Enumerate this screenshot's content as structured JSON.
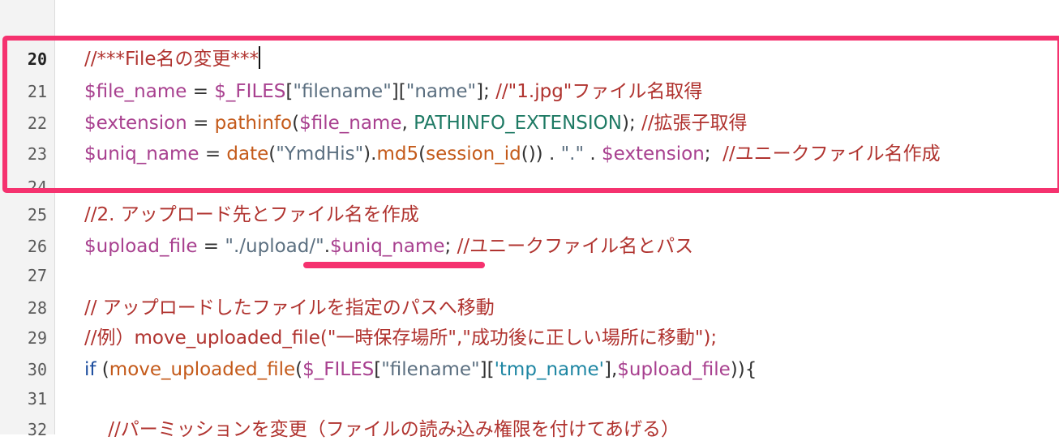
{
  "editor": {
    "lines": [
      {
        "number": "20",
        "tokens": [
          {
            "t": "//***File名の変更***",
            "c": "cm"
          }
        ]
      },
      {
        "number": "21",
        "tokens": [
          {
            "t": "$file_name",
            "c": "vr"
          },
          {
            "t": " = ",
            "c": "pl"
          },
          {
            "t": "$_FILES",
            "c": "vr"
          },
          {
            "t": "[",
            "c": "pl"
          },
          {
            "t": "\"filename\"",
            "c": "st"
          },
          {
            "t": "][",
            "c": "pl"
          },
          {
            "t": "\"name\"",
            "c": "st"
          },
          {
            "t": "]; ",
            "c": "pl"
          },
          {
            "t": "//\"1.jpg\"ファイル名取得",
            "c": "cm"
          }
        ]
      },
      {
        "number": "22",
        "tokens": [
          {
            "t": "$extension",
            "c": "vr"
          },
          {
            "t": " = ",
            "c": "pl"
          },
          {
            "t": "pathinfo",
            "c": "fn"
          },
          {
            "t": "(",
            "c": "pl"
          },
          {
            "t": "$file_name",
            "c": "vr"
          },
          {
            "t": ", ",
            "c": "pl"
          },
          {
            "t": "PATHINFO_EXTENSION",
            "c": "cn"
          },
          {
            "t": "); ",
            "c": "pl"
          },
          {
            "t": "//拡張子取得",
            "c": "cm"
          }
        ]
      },
      {
        "number": "23",
        "tokens": [
          {
            "t": "$uniq_name",
            "c": "vr"
          },
          {
            "t": " = ",
            "c": "pl"
          },
          {
            "t": "date",
            "c": "fn"
          },
          {
            "t": "(",
            "c": "pl"
          },
          {
            "t": "\"YmdHis\"",
            "c": "st"
          },
          {
            "t": ").",
            "c": "pl"
          },
          {
            "t": "md5",
            "c": "fn"
          },
          {
            "t": "(",
            "c": "pl"
          },
          {
            "t": "session_id",
            "c": "fn"
          },
          {
            "t": "()) . ",
            "c": "pl"
          },
          {
            "t": "\".\"",
            "c": "st"
          },
          {
            "t": " . ",
            "c": "pl"
          },
          {
            "t": "$extension",
            "c": "vr"
          },
          {
            "t": ";  ",
            "c": "pl"
          },
          {
            "t": "//ユニークファイル名作成",
            "c": "cm"
          }
        ]
      },
      {
        "number": "24",
        "tokens": []
      },
      {
        "number": "25",
        "tokens": [
          {
            "t": "//2. アップロード先とファイル名を作成",
            "c": "cm"
          }
        ]
      },
      {
        "number": "26",
        "tokens": [
          {
            "t": "$upload_file",
            "c": "vr"
          },
          {
            "t": " = ",
            "c": "pl"
          },
          {
            "t": "\"./upload/\"",
            "c": "st"
          },
          {
            "t": ".",
            "c": "pl"
          },
          {
            "t": "$uniq_name",
            "c": "vr"
          },
          {
            "t": "; ",
            "c": "pl"
          },
          {
            "t": "//ユニークファイル名とパス",
            "c": "cm"
          }
        ]
      },
      {
        "number": "27",
        "tokens": []
      },
      {
        "number": "28",
        "tokens": [
          {
            "t": "// アップロードしたファイルを指定のパスへ移動",
            "c": "cm"
          }
        ]
      },
      {
        "number": "29",
        "tokens": [
          {
            "t": "//例）move_uploaded_file(\"一時保存場所\",\"成功後に正しい場所に移動\");",
            "c": "cm"
          }
        ]
      },
      {
        "number": "30",
        "tokens": [
          {
            "t": "if",
            "c": "kw"
          },
          {
            "t": " (",
            "c": "pl"
          },
          {
            "t": "move_uploaded_file",
            "c": "fn"
          },
          {
            "t": "(",
            "c": "pl"
          },
          {
            "t": "$_FILES",
            "c": "vr"
          },
          {
            "t": "[",
            "c": "pl"
          },
          {
            "t": "\"filename\"",
            "c": "st"
          },
          {
            "t": "][",
            "c": "pl"
          },
          {
            "t": "'tmp_name'",
            "c": "sq"
          },
          {
            "t": "],",
            "c": "pl"
          },
          {
            "t": "$upload_file",
            "c": "vr"
          },
          {
            "t": ")){",
            "c": "pl"
          }
        ]
      },
      {
        "number": "31",
        "tokens": []
      },
      {
        "number": "32",
        "tokens": [
          {
            "t": "    //パーミッションを変更（ファイルの読み込み権限を付けてあげる）",
            "c": "cm"
          }
        ]
      }
    ]
  },
  "colors": {
    "highlight": "#f5326f",
    "comment": "#b0332f",
    "variable": "#a8408f",
    "function": "#c45a1a",
    "string": "#5b6f80",
    "constant": "#1e7a64",
    "keyword": "#1c4d9e"
  }
}
